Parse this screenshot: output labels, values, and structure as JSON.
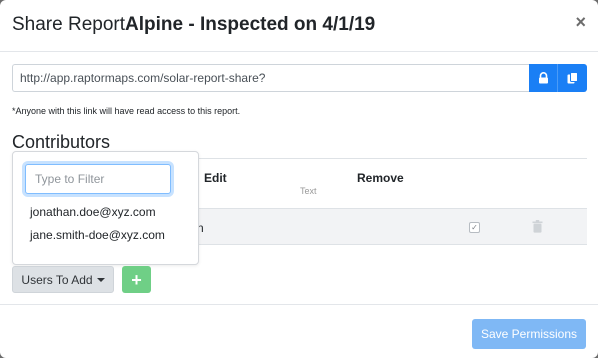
{
  "modal": {
    "title_prefix": "Share Report",
    "title_bold": "Alpine - Inspected on 4/1/19",
    "close_symbol": "×"
  },
  "share_link": {
    "value": "http://app.raptormaps.com/solar-report-share?",
    "lock_icon": "lock-icon",
    "copy_icon": "copy-icon"
  },
  "note": "*Anyone with this link will have read access to this report.",
  "contributors": {
    "heading": "Contributors",
    "columns": {
      "edit": "Edit",
      "remove": "Remove"
    },
    "ghost_text": "Text",
    "row": {
      "partial_name": "n",
      "edit_checked": true
    }
  },
  "user_dropdown": {
    "filter_placeholder": "Type to Filter",
    "items": [
      "jonathan.doe@xyz.com",
      "jane.smith-doe@xyz.com"
    ],
    "toggle_label": "Users To Add",
    "add_symbol": "+"
  },
  "footer": {
    "save_label": "Save Permissions"
  },
  "colors": {
    "primary": "#1a7ff5",
    "success_disabled": "#6fcf86",
    "primary_disabled": "#7fb8f5"
  }
}
